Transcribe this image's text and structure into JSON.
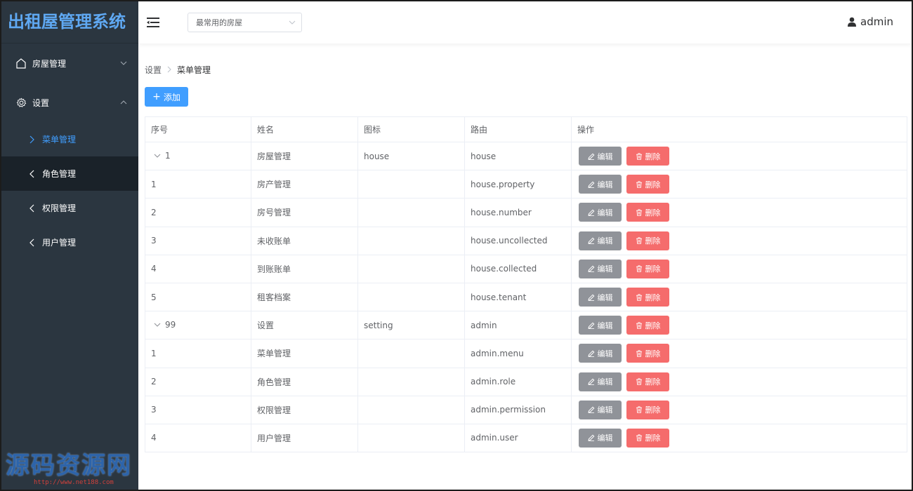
{
  "app": {
    "title": "出租屋管理系统"
  },
  "sidebar": {
    "groups": [
      {
        "label": "房屋管理",
        "icon": "home-icon",
        "expanded": false
      },
      {
        "label": "设置",
        "icon": "gear-icon",
        "expanded": true
      }
    ],
    "items": [
      {
        "label": "菜单管理",
        "active": true
      },
      {
        "label": "角色管理",
        "active": false
      },
      {
        "label": "权限管理",
        "active": false
      },
      {
        "label": "用户管理",
        "active": false
      }
    ]
  },
  "header": {
    "select_value": "最常用的房屋",
    "user_name": "admin"
  },
  "breadcrumb": {
    "parent": "设置",
    "current": "菜单管理"
  },
  "toolbar": {
    "add_label": "添加"
  },
  "table": {
    "headers": [
      "序号",
      "姓名",
      "图标",
      "路由",
      "操作"
    ],
    "edit_label": "编辑",
    "delete_label": "删除",
    "rows": [
      {
        "id": "1",
        "name": "房屋管理",
        "icon": "house",
        "route": "house",
        "parent": true
      },
      {
        "id": "1",
        "name": "房产管理",
        "icon": "",
        "route": "house.property",
        "parent": false
      },
      {
        "id": "2",
        "name": "房号管理",
        "icon": "",
        "route": "house.number",
        "parent": false
      },
      {
        "id": "3",
        "name": "未收账单",
        "icon": "",
        "route": "house.uncollected",
        "parent": false
      },
      {
        "id": "4",
        "name": "到账账单",
        "icon": "",
        "route": "house.collected",
        "parent": false
      },
      {
        "id": "5",
        "name": "租客档案",
        "icon": "",
        "route": "house.tenant",
        "parent": false
      },
      {
        "id": "99",
        "name": "设置",
        "icon": "setting",
        "route": "admin",
        "parent": true
      },
      {
        "id": "1",
        "name": "菜单管理",
        "icon": "",
        "route": "admin.menu",
        "parent": false
      },
      {
        "id": "2",
        "name": "角色管理",
        "icon": "",
        "route": "admin.role",
        "parent": false
      },
      {
        "id": "3",
        "name": "权限管理",
        "icon": "",
        "route": "admin.permission",
        "parent": false
      },
      {
        "id": "4",
        "name": "用户管理",
        "icon": "",
        "route": "admin.user",
        "parent": false
      }
    ]
  },
  "watermark": {
    "text": "源码资源网",
    "url": "http://www.net188.com"
  },
  "colors": {
    "primary": "#409eff",
    "danger": "#f56c6c",
    "info": "#909399",
    "sidebar": "#2b3640",
    "brand": "#5fa8f2"
  }
}
